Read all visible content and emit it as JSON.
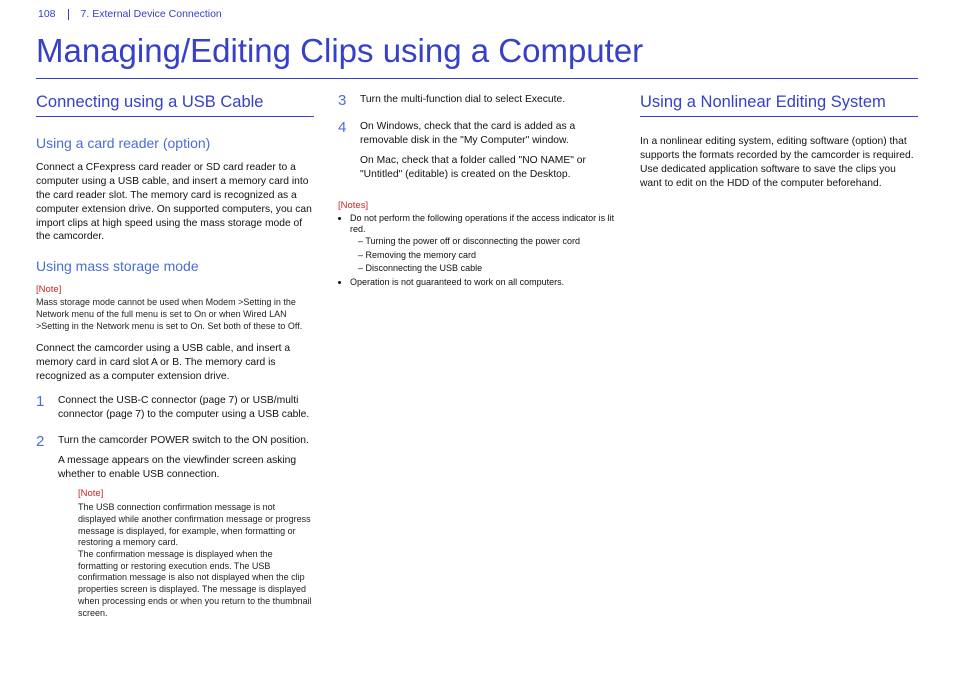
{
  "header": {
    "page_number": "108",
    "section": "7. External Device Connection"
  },
  "title": "Managing/Editing Clips using a Computer",
  "col1": {
    "h2": "Connecting using a USB Cable",
    "card_reader": {
      "heading": "Using a card reader (option)",
      "body": "Connect a CFexpress card reader or SD card reader to a computer using a USB cable, and insert a memory card into the card reader slot. The memory card is recognized as a computer extension drive. On supported computers, you can import clips at high speed using the mass storage mode of the camcorder."
    },
    "mass_storage": {
      "heading": "Using mass storage mode",
      "note_label": "[Note]",
      "note_text": "Mass storage mode cannot be used when Modem >Setting in the Network menu of the full menu is set to On or when Wired LAN >Setting in the Network menu is set to On. Set both of these to Off.",
      "body": "Connect the camcorder using a USB cable, and insert a memory card in card slot A or B. The memory card is recognized as a computer extension drive."
    },
    "step1": {
      "num": "1",
      "body": "Connect the USB-C connector (page 7) or USB/multi connector (page 7) to the computer using a USB cable."
    },
    "step2": {
      "num": "2",
      "body_a": "Turn the camcorder POWER switch to the ON position.",
      "body_b": "A message appears on the viewfinder screen asking whether to enable USB connection.",
      "note_label": "[Note]",
      "note_text": "The USB connection confirmation message is not displayed while another confirmation message or progress message is displayed, for example, when formatting or restoring a memory card.\nThe confirmation message is displayed when the formatting or restoring execution ends. The USB confirmation message is also not displayed when the clip properties screen is displayed. The message is displayed when processing ends or when you return to the thumbnail screen."
    }
  },
  "col2": {
    "step3": {
      "num": "3",
      "body": "Turn the multi-function dial to select Execute."
    },
    "step4": {
      "num": "4",
      "body_a": "On Windows, check that the card is added as a removable disk in the \"My Computer\" window.",
      "body_b": "On Mac, check that a folder called \"NO NAME\" or \"Untitled\" (editable) is created on the Desktop."
    },
    "notes_label": "[Notes]",
    "bullet1": "Do not perform the following operations if the access indicator is lit red.",
    "dash1": "Turning the power off or disconnecting the power cord",
    "dash2": "Removing the memory card",
    "dash3": "Disconnecting the USB cable",
    "bullet2": "Operation is not guaranteed to work on all computers."
  },
  "col3": {
    "h2": "Using a Nonlinear Editing System",
    "body_a": "In a nonlinear editing system, editing software (option) that supports the formats recorded by the camcorder is required.",
    "body_b": "Use dedicated application software to save the clips you want to edit on the HDD of the computer beforehand."
  }
}
